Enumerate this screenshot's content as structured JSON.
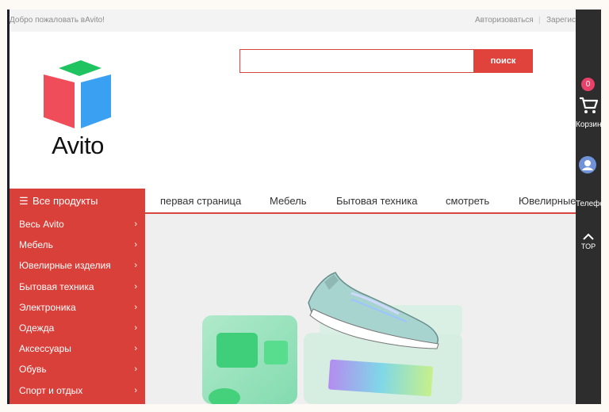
{
  "topbar": {
    "welcome": "Добро пожаловать вAvito!",
    "login": "Авторизоваться",
    "separator": "|",
    "register": "Зарегистрироваться"
  },
  "logo": {
    "text": "Avito"
  },
  "search": {
    "placeholder": "",
    "button_label": "поиск"
  },
  "nav": {
    "all_products": "Все продукты",
    "tabs": [
      "первая страница",
      "Мебель",
      "Бытовая техника",
      "смотреть",
      "Ювелирные"
    ]
  },
  "categories": [
    "Весь Avito",
    "Мебель",
    "Ювелирные изделия",
    "Бытовая техника",
    "Электроника",
    "Одежда",
    "Аксессуары",
    "Обувь",
    "Спорт и отдых"
  ],
  "rightbar": {
    "cart_count": "0",
    "cart_label": "Корзина",
    "phone_label": "Телефон",
    "top_label": "TOP"
  },
  "colors": {
    "accent": "#d9403a",
    "sidebar_dark": "#2d2d2d",
    "badge": "#e8416a"
  }
}
